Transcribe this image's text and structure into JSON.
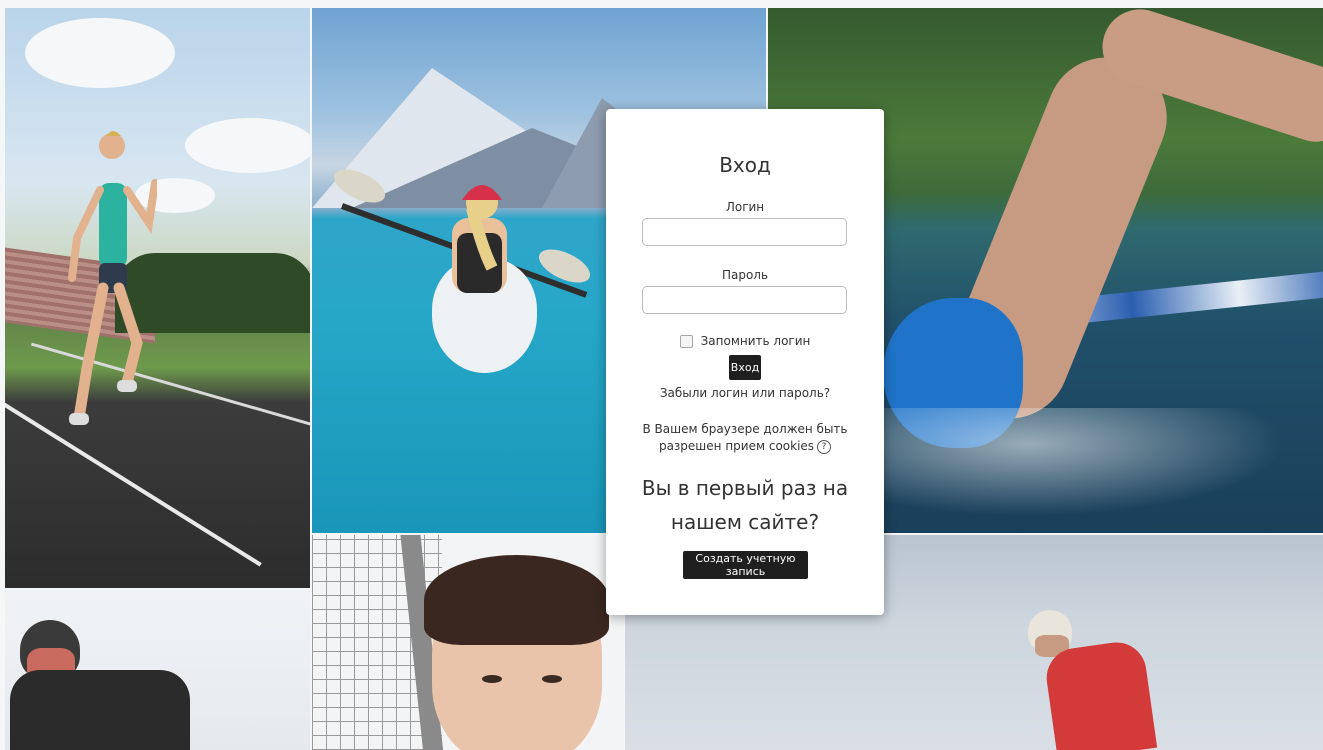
{
  "login": {
    "title": "Вход",
    "username_label": "Логин",
    "username_value": "",
    "password_label": "Пароль",
    "password_value": "",
    "remember_label": "Запомнить логин",
    "remember_checked": false,
    "submit_label": "Вход",
    "forgot_link": "Забыли логин или пароль?",
    "cookies_notice": "В Вашем браузере должен быть разрешен прием cookies",
    "help_icon": "help-icon"
  },
  "signup": {
    "heading": "Вы в первый раз на нашем сайте?",
    "button_label": "Создать учетную запись"
  },
  "colors": {
    "button_bg": "#1f1f1f",
    "card_bg": "#ffffff",
    "text": "#333333"
  },
  "background": {
    "tiles": [
      "runner-photo",
      "kayak-photo",
      "swimmer-photo",
      "skier-photo",
      "tennis-player-photo",
      "snowboarder-photo"
    ]
  }
}
